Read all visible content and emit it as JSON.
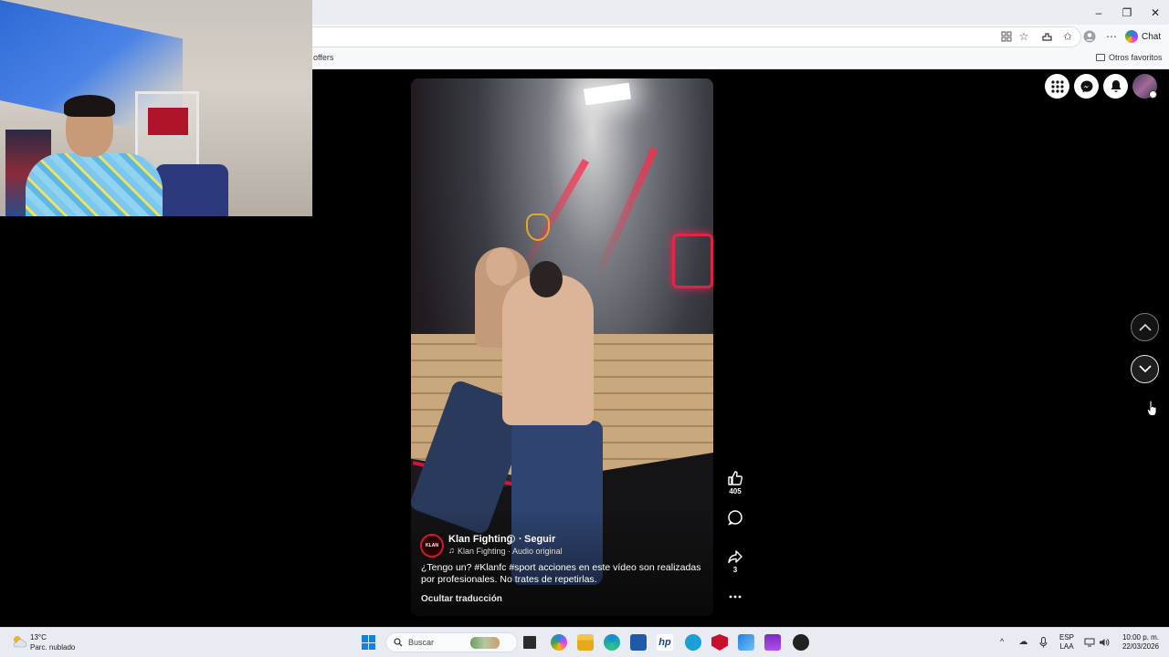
{
  "browser": {
    "favorites_bar": {
      "offers_label": "offers",
      "others_label": "Otros favoritos"
    },
    "toolbar": {
      "chat_label": "Chat"
    },
    "window_controls": {
      "minimize": "–",
      "restore": "❐",
      "close": "✕"
    }
  },
  "reel": {
    "author": {
      "name": "Klan Fighting",
      "follow_sep": "·",
      "follow_label": "Seguir",
      "avatar_text": "KLAN"
    },
    "audio": "Klan Fighting · Audio original",
    "caption": "¿Tengo un? #Klanfc #sport acciones en este vídeo son realizadas por profesionales. No trates de repetirlas.",
    "translation_toggle": "Ocultar traducción",
    "actions": {
      "likes": "405",
      "shares": "3"
    }
  },
  "taskbar": {
    "weather": {
      "temp": "13°C",
      "desc": "Parc. nublado"
    },
    "search_placeholder": "Buscar",
    "language": {
      "line1": "ESP",
      "line2": "LAA"
    },
    "clock": {
      "time": "10:00 p. m.",
      "date": "22/03/2026"
    }
  },
  "colors": {
    "accent_red": "#c81d2e",
    "windows_blue": "#1a7fd6",
    "page_bg": "#000000"
  }
}
